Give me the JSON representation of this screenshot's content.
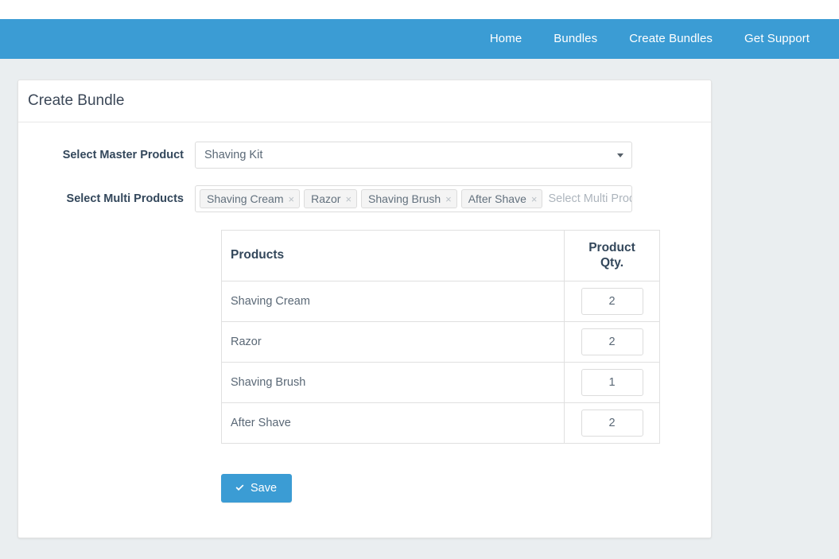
{
  "theme": {
    "navbar_bg": "#3b9cd4",
    "page_bg": "#eaeef0",
    "card_bg": "#ffffff",
    "primary_button_bg": "#3b9cd4",
    "label_color": "#33475b",
    "text_color": "#5a6876"
  },
  "navbar": {
    "items": [
      {
        "label": "Home",
        "name": "nav-item-home"
      },
      {
        "label": "Bundles",
        "name": "nav-item-bundles"
      },
      {
        "label": "Create Bundles",
        "name": "nav-item-create-bundles"
      },
      {
        "label": "Get Support",
        "name": "nav-item-get-support"
      }
    ]
  },
  "card": {
    "title": "Create Bundle"
  },
  "form": {
    "master_product": {
      "label": "Select Master Product",
      "value": "Shaving Kit",
      "caret_icon": "chevron-down-icon"
    },
    "multi_products": {
      "label": "Select Multi Products",
      "placeholder": "Select Multi Products",
      "remove_glyph": "×",
      "tags": [
        {
          "label": "Shaving Cream"
        },
        {
          "label": "Razor"
        },
        {
          "label": "Shaving Brush"
        },
        {
          "label": "After Shave"
        }
      ]
    }
  },
  "table": {
    "headers": {
      "products": "Products",
      "qty_line1": "Product",
      "qty_line2": "Qty."
    },
    "rows": [
      {
        "product": "Shaving Cream",
        "qty": "2"
      },
      {
        "product": "Razor",
        "qty": "2"
      },
      {
        "product": "Shaving Brush",
        "qty": "1"
      },
      {
        "product": "After Shave",
        "qty": "2"
      }
    ]
  },
  "actions": {
    "save_label": "Save",
    "save_icon": "check-icon"
  }
}
